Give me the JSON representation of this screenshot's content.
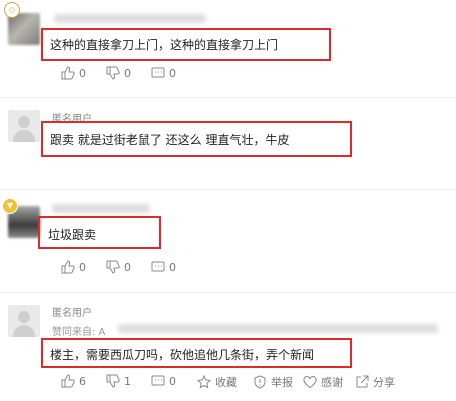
{
  "comments": [
    {
      "username": "",
      "content": "这种的直接拿刀上门，这种的直接拿刀上门",
      "likes": "0",
      "dislikes": "0",
      "replies": "0"
    },
    {
      "username": "匿名用户",
      "content": "跟卖 就是过街老鼠了 还这么 理直气壮，牛皮"
    },
    {
      "username": "",
      "content": "垃圾跟卖",
      "likes": "0",
      "dislikes": "0",
      "replies": "0"
    },
    {
      "username": "匿名用户",
      "reply_from": "赞同来自: A",
      "content": "楼主，需要西瓜刀吗，砍他追他几条街，弄个新闻",
      "likes": "6",
      "dislikes": "1",
      "replies": "0",
      "collect": "收藏",
      "report": "举报",
      "thanks": "感谢",
      "share": "分享"
    }
  ],
  "colors": {
    "highlight_box": "#e02a2a",
    "badge": "#f1c232"
  }
}
